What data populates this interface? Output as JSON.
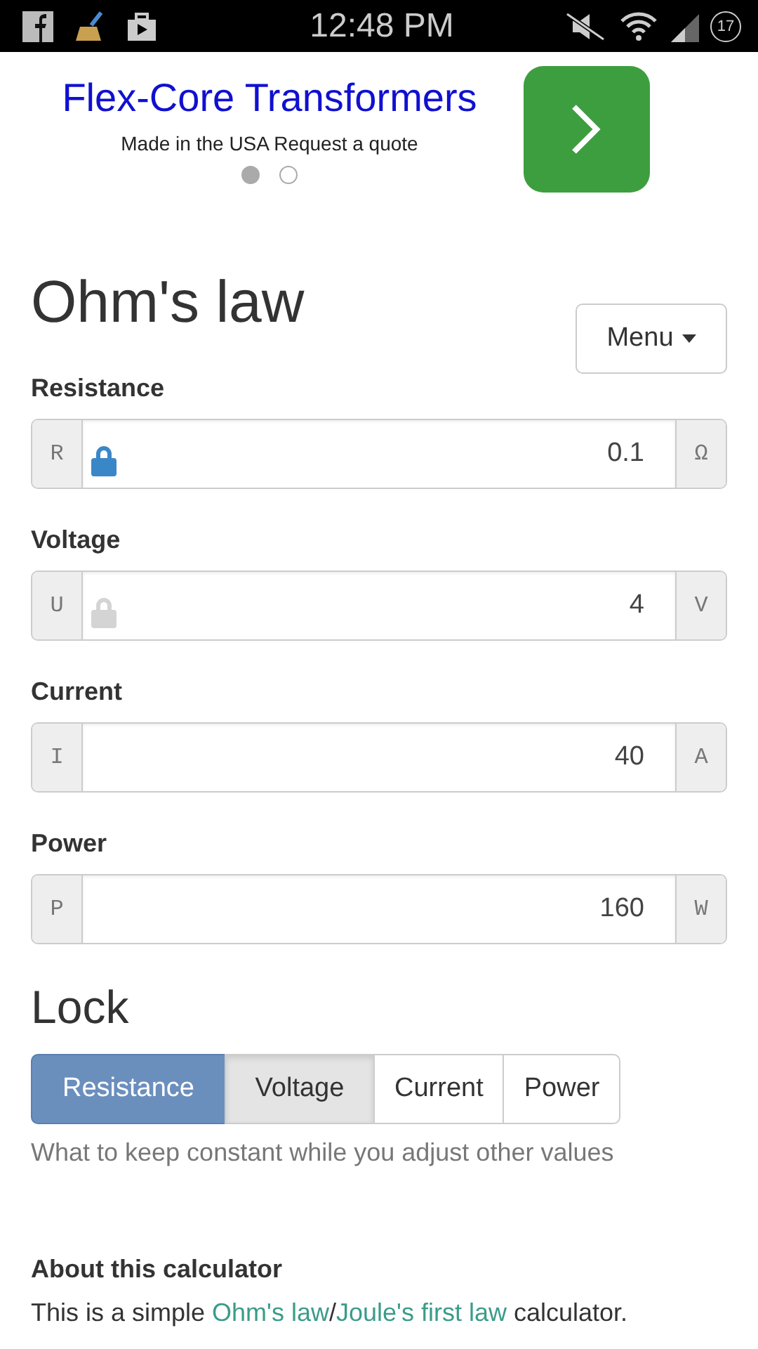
{
  "status_bar": {
    "time": "12:48 PM",
    "battery": "17"
  },
  "ad": {
    "title": "Flex-Core Transformers",
    "subtitle": "Made in the USA Request a quote",
    "dots": [
      {
        "selected": true
      },
      {
        "selected": false
      }
    ]
  },
  "title": "Ohm's law",
  "menu_button": "Menu",
  "fields": [
    {
      "label": "Resistance",
      "symbol": "R",
      "value": "0.1",
      "unit": "Ω",
      "locked": true
    },
    {
      "label": "Voltage",
      "symbol": "U",
      "value": "4",
      "unit": "V",
      "locked": false
    },
    {
      "label": "Current",
      "symbol": "I",
      "value": "40",
      "unit": "A"
    },
    {
      "label": "Power",
      "symbol": "P",
      "value": "160",
      "unit": "W"
    }
  ],
  "lock": {
    "heading": "Lock",
    "buttons": [
      {
        "label": "Resistance",
        "selected": true,
        "pressed": false
      },
      {
        "label": "Voltage",
        "selected": false,
        "pressed": true
      },
      {
        "label": "Current",
        "selected": false,
        "pressed": false
      },
      {
        "label": "Power",
        "selected": false,
        "pressed": false
      }
    ],
    "help": "What to keep constant while you adjust other values"
  },
  "about": {
    "heading": "About this calculator",
    "text": [
      {
        "kind": "text",
        "text": "This is a simple "
      },
      {
        "kind": "link",
        "text": "Ohm's law"
      },
      {
        "kind": "text",
        "text": "/"
      },
      {
        "kind": "link",
        "text": "Joule's first law"
      },
      {
        "kind": "text",
        "text": " calculator."
      }
    ]
  }
}
